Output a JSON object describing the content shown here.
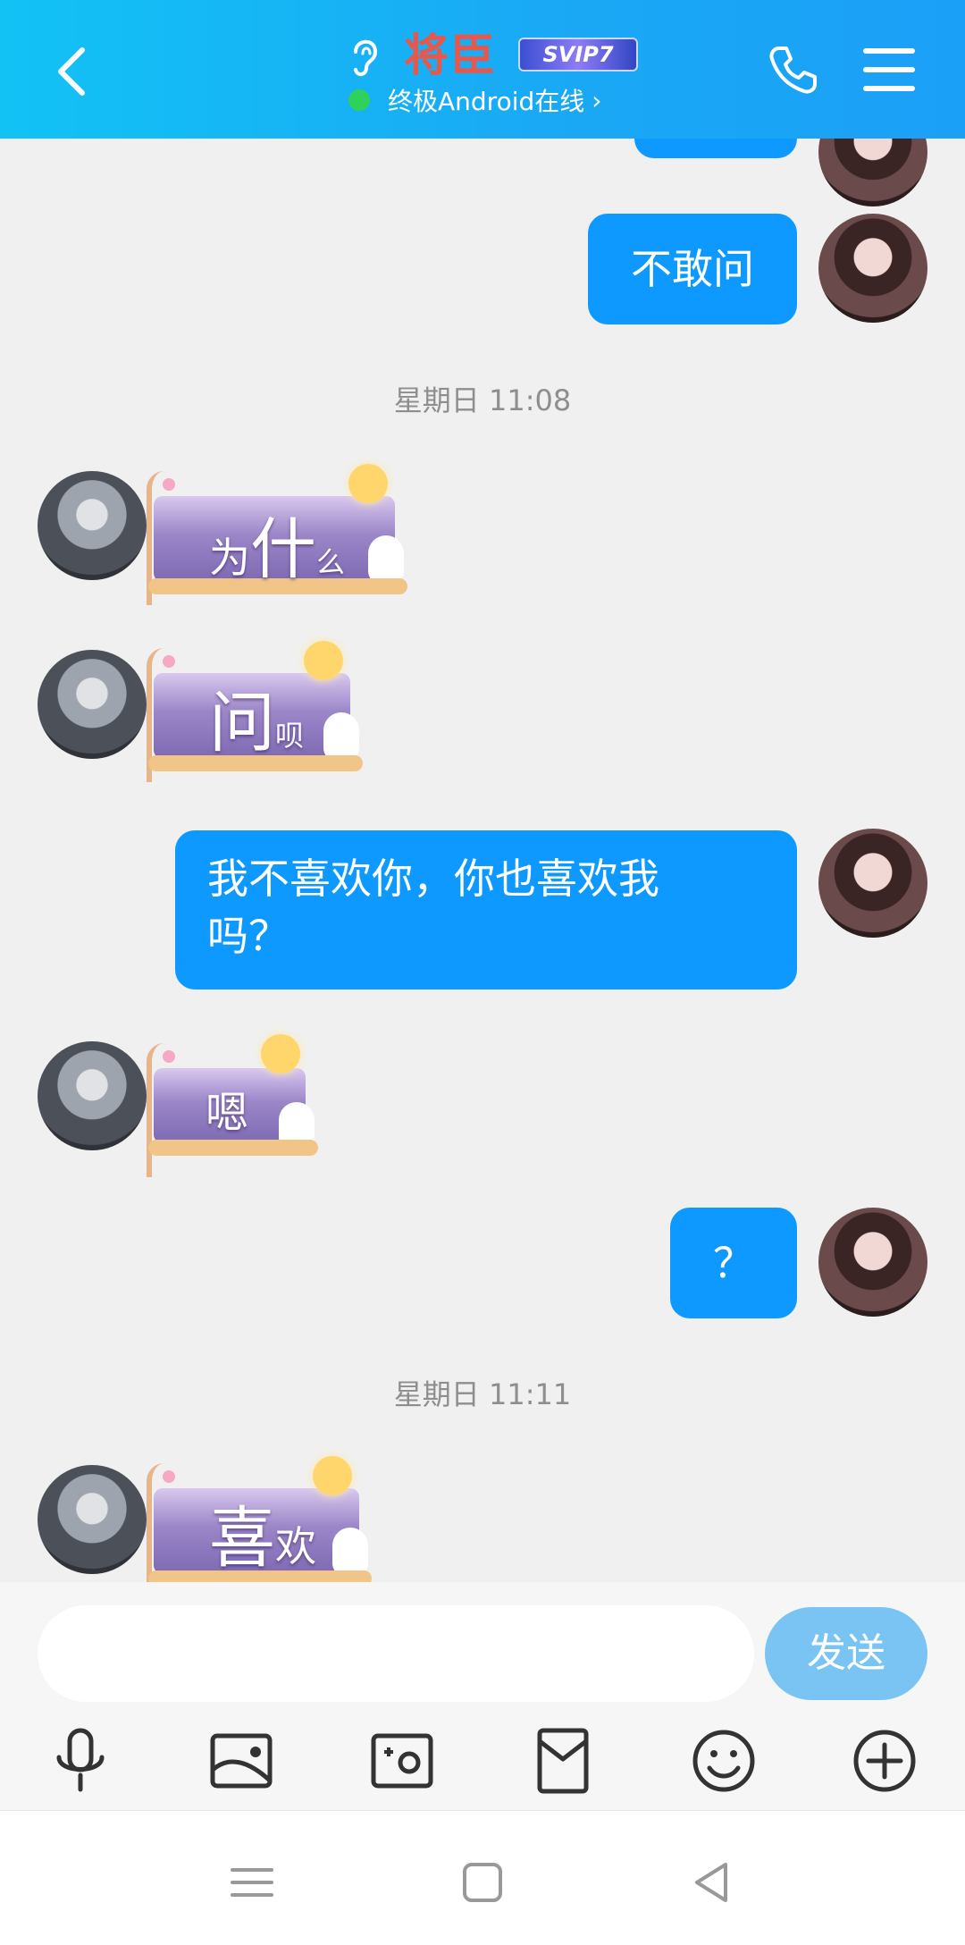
{
  "header": {
    "contact_name": "将臣",
    "vip_badge": "SVIP7",
    "status_text": "终极Android在线",
    "colors": {
      "gradient_start": "#12c2f5",
      "gradient_end": "#1ba0f7",
      "online_dot": "#2ed15a",
      "name": "#e8574a"
    }
  },
  "messages": {
    "m1": {
      "text": "不敢问"
    },
    "ts1": {
      "text": "星期日 11:08"
    },
    "m2": {
      "text_large": "为",
      "text_big": "什",
      "text_small": "么"
    },
    "m3": {
      "text_big": "问",
      "text_small": "呗"
    },
    "m4": {
      "line1": "我不喜欢你，你也喜欢我",
      "line2": "吗？"
    },
    "m5": {
      "text": "嗯"
    },
    "m6": {
      "text": "？"
    },
    "ts2": {
      "text": "星期日 11:11"
    },
    "m7": {
      "text_big": "喜",
      "text_small": "欢"
    }
  },
  "composer": {
    "input_value": "",
    "send_label": "发送",
    "colors": {
      "send_bg": "#7ac4f4",
      "my_bubble": "#0d99ff"
    }
  },
  "toolbar": {
    "icons": [
      "microphone-icon",
      "image-icon",
      "camera-icon",
      "red-packet-icon",
      "emoji-icon",
      "plus-icon"
    ]
  },
  "navbar": {
    "icons": [
      "menu-nav-icon",
      "home-nav-icon",
      "back-nav-icon"
    ]
  }
}
